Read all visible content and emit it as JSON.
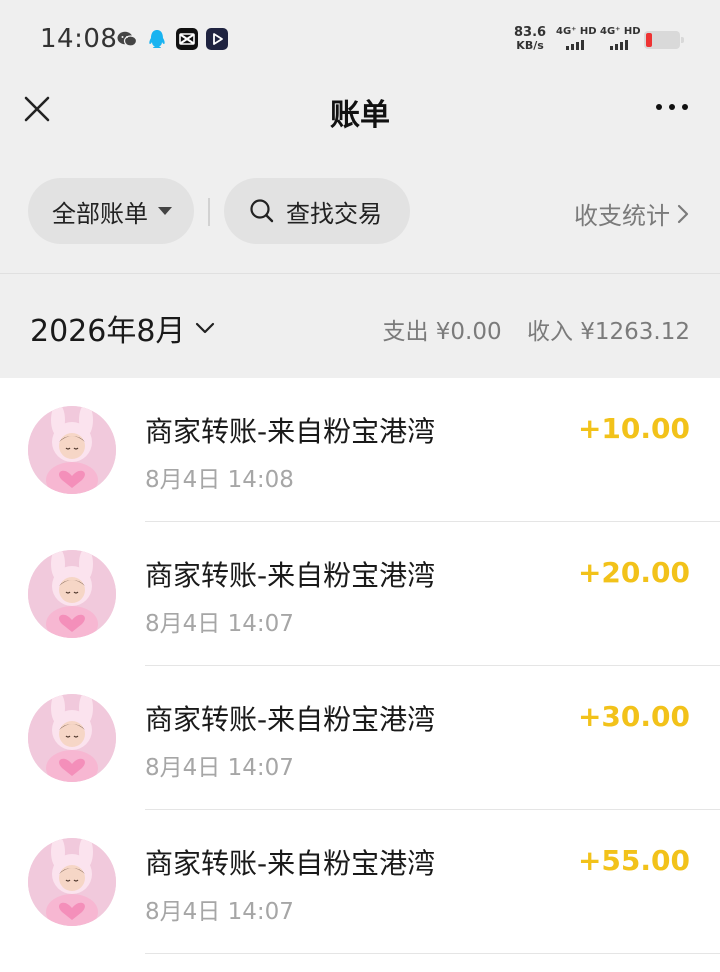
{
  "status_bar": {
    "time": "14:08",
    "speed_value": "83.6",
    "speed_unit": "KB/s",
    "net1": "4G⁺ HD",
    "net2": "4G⁺ HD",
    "notification_icons": [
      "wechat-icon",
      "qq-icon",
      "capcut-icon",
      "video-app-icon"
    ],
    "battery_level": 0.15
  },
  "nav": {
    "title": "账单",
    "close_icon": "close-icon",
    "more_icon": "more-icon"
  },
  "filters": {
    "all_bills_label": "全部账单",
    "search_label": "查找交易",
    "stats_label": "收支统计"
  },
  "month_header": {
    "month_label": "2026年8月",
    "expense_label": "支出",
    "expense_value": "¥0.00",
    "income_label": "收入",
    "income_value": "¥1263.12"
  },
  "transactions": [
    {
      "title": "商家转账-来自粉宝港湾",
      "time": "8月4日 14:08",
      "amount": "+10.00"
    },
    {
      "title": "商家转账-来自粉宝港湾",
      "time": "8月4日 14:07",
      "amount": "+20.00"
    },
    {
      "title": "商家转账-来自粉宝港湾",
      "time": "8月4日 14:07",
      "amount": "+30.00"
    },
    {
      "title": "商家转账-来自粉宝港湾",
      "time": "8月4日 14:07",
      "amount": "+55.00"
    }
  ],
  "colors": {
    "background": "#efefef",
    "list_background": "#ffffff",
    "amount": "#f2c21a",
    "secondary_text": "#7b7b7b",
    "pill": "#e2e2e2"
  }
}
